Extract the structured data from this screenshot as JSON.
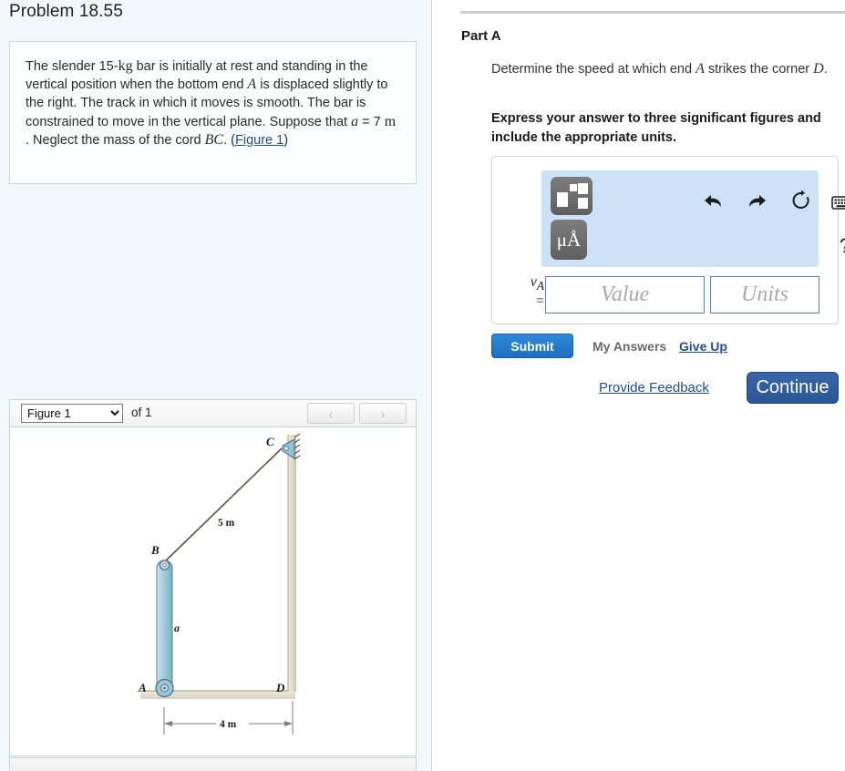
{
  "problem": {
    "title": "Problem 18.55",
    "text_1": "The slender 15-",
    "unit_kg": "kg",
    "text_2": " bar is initially at rest and standing in the vertical position when the bottom end ",
    "var_A": "A",
    "text_3": " is displaced slightly to the right. The track in which it moves is smooth. The bar is constrained to move in the vertical plane. Suppose that ",
    "var_a": "a",
    "text_4": " = 7 ",
    "unit_m": "m",
    "text_5": " . Neglect the mass of the cord ",
    "var_BC": "BC",
    "text_6": ". (",
    "figure_link": "Figure 1",
    "text_7": ")"
  },
  "figure": {
    "select_value": "Figure 1",
    "options": [
      "Figure 1"
    ],
    "of_label": "of 1",
    "prev_icon": "chevron-left-icon",
    "next_icon": "chevron-right-icon",
    "labels": {
      "point_A": "A",
      "point_B": "B",
      "point_C": "C",
      "point_D": "D",
      "cord_length": "5 m",
      "bar_length": "a",
      "base_length": "4 m"
    },
    "colors": {
      "bar_fill": "#a9cfe0",
      "bar_stroke": "#5b7f90",
      "ground": "#e2ddc9",
      "wall": "#ded9c6",
      "cord": "#555550"
    }
  },
  "part": {
    "title": "Part A",
    "question_1": "Determine the speed at which end ",
    "question_var": "A",
    "question_2": " strikes the corner ",
    "question_var2": "D",
    "question_3": ".",
    "instruction": "Express your answer to three significant figures and include the appropriate units."
  },
  "answer": {
    "toolbar": {
      "template_icon": "math-template-icon",
      "units_icon": "μÅ",
      "undo_icon": "undo-icon",
      "redo_icon": "redo-icon",
      "reset_icon": "reset-icon",
      "keyboard_icon": "keyboard-icon",
      "help_icon": "?"
    },
    "variable": "v",
    "subscript": "A",
    "equals": "=",
    "value_placeholder": "Value",
    "units_placeholder": "Units",
    "value": "",
    "units": ""
  },
  "actions": {
    "submit": "Submit",
    "my_answers": "My Answers",
    "give_up": "Give Up",
    "provide_feedback": "Provide Feedback",
    "continue": "Continue"
  },
  "colors": {
    "submit_blue": "#1d6fc0",
    "continue_blue": "#2b5696",
    "link_blue": "#1f4f8f",
    "panel_blue": "#f2f7fc",
    "toolbar_blue": "#cde1f7"
  }
}
